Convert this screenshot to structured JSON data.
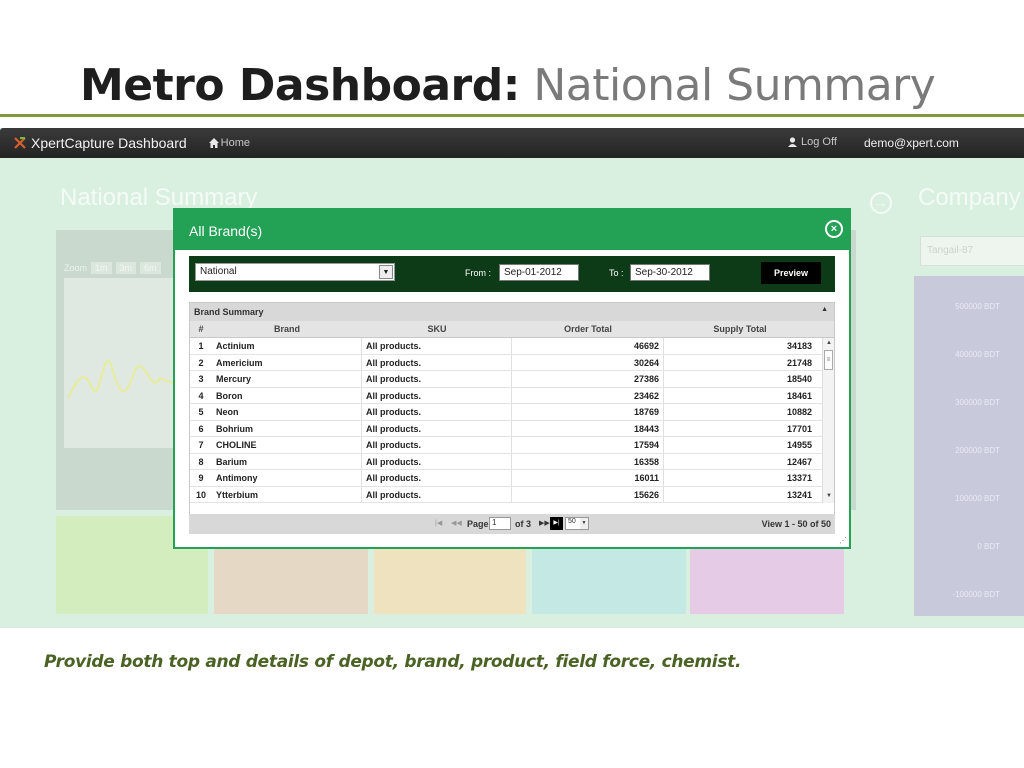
{
  "slide": {
    "title_strong": "Metro Dashboard:",
    "title_light": "National Summary",
    "footnote": "Provide  both top and details of depot, brand, product, field force, chemist."
  },
  "navbar": {
    "brand": "XpertCapture Dashboard",
    "home": "Home",
    "logoff": "Log Off",
    "user": "demo@xpert.com"
  },
  "background": {
    "heading_left": "National Summary",
    "heading_right": "Company",
    "zoom_label": "Zoom",
    "zoom_options": [
      "1m",
      "3m",
      "6m"
    ],
    "right_select": "Tangail-87",
    "y_ticks": [
      "500000 BDT",
      "400000 BDT",
      "300000 BDT",
      "200000 BDT",
      "100000 BDT",
      "0 BDT",
      "-100000 BDT"
    ]
  },
  "modal": {
    "title": "All Brand(s)",
    "filters": {
      "region": "National",
      "from_label": "From :",
      "from_value": "Sep-01-2012",
      "to_label": "To :",
      "to_value": "Sep-30-2012",
      "preview_label": "Preview"
    },
    "grid": {
      "caption": "Brand Summary",
      "headers": [
        "#",
        "Brand",
        "SKU",
        "Order Total",
        "Supply Total"
      ],
      "rows": [
        [
          "1",
          "Actinium",
          "All products.",
          "46692",
          "34183"
        ],
        [
          "2",
          "Americium",
          "All products.",
          "30264",
          "21748"
        ],
        [
          "3",
          "Mercury",
          "All products.",
          "27386",
          "18540"
        ],
        [
          "4",
          "Boron",
          "All products.",
          "23462",
          "18461"
        ],
        [
          "5",
          "Neon",
          "All products.",
          "18769",
          "10882"
        ],
        [
          "6",
          "Bohrium",
          "All products.",
          "18443",
          "17701"
        ],
        [
          "7",
          "CHOLINE",
          "All products.",
          "17594",
          "14955"
        ],
        [
          "8",
          "Barium",
          "All products.",
          "16358",
          "12467"
        ],
        [
          "9",
          "Antimony",
          "All products.",
          "16011",
          "13371"
        ],
        [
          "10",
          "Ytterbium",
          "All products.",
          "15626",
          "13241"
        ]
      ]
    },
    "pager": {
      "page_label": "Page",
      "page_value": "1",
      "of_label": "of 3",
      "rows_per_page": "50",
      "view_label": "View 1 - 50 of 50"
    }
  },
  "colors": {
    "modal_green": "#23a155",
    "filter_bar": "#0d3b17",
    "title_rule": "#7e9a3c",
    "footnote": "#4a6224"
  }
}
